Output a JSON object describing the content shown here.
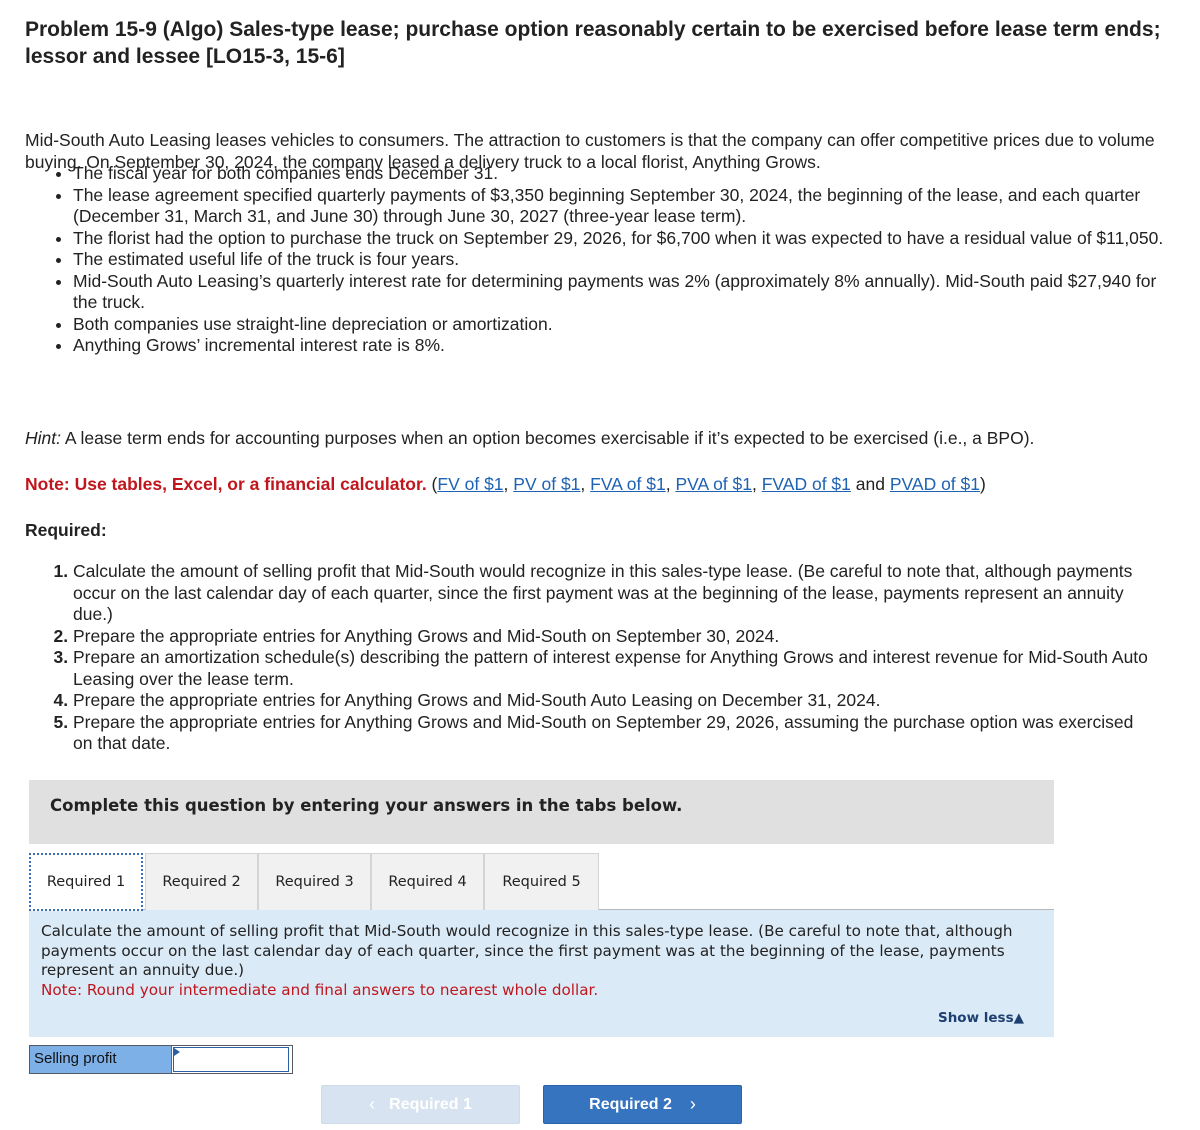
{
  "problem": {
    "title": "Problem 15-9 (Algo) Sales-type lease; purchase option reasonably certain to be exercised before lease term ends; lessor and lessee [LO15-3, 15-6]",
    "intro": "Mid-South Auto Leasing leases vehicles to consumers. The attraction to customers is that the company can offer competitive prices due to volume buying. On September 30, 2024, the company leased a delivery truck to a local florist, Anything Grows.",
    "facts": [
      "The fiscal year for both companies ends December 31.",
      "The lease agreement specified quarterly payments of $3,350 beginning September 30, 2024, the beginning of the lease, and each quarter (December 31, March 31, and June 30) through June 30, 2027 (three-year lease term).",
      "The florist had the option to purchase the truck on September 29, 2026, for $6,700 when it was expected to have a residual value of $11,050.",
      "The estimated useful life of the truck is four years.",
      "Mid-South Auto Leasing’s quarterly interest rate for determining payments was 2% (approximately 8% annually). Mid-South paid $27,940 for the truck.",
      "Both companies use straight-line depreciation or amortization.",
      "Anything Grows’ incremental interest rate is 8%."
    ],
    "hint_label": "Hint:",
    "hint_text": " A lease term ends for accounting purposes when an option becomes exercisable if it’s expected to be exercised (i.e., a BPO).",
    "note_label": "Note: Use tables, Excel, or a financial calculator.",
    "note_links": [
      "FV of $1",
      "PV of $1",
      "FVA of $1",
      "PVA of $1",
      "FVAD of $1",
      "PVAD of $1"
    ],
    "note_and": "and",
    "required_heading": "Required:",
    "required_items": [
      "Calculate the amount of selling profit that Mid-South would recognize in this sales-type lease. (Be careful to note that, although payments occur on the last calendar day of each quarter, since the first payment was at the beginning of the lease, payments represent an annuity due.)",
      "Prepare the appropriate entries for Anything Grows and Mid-South on September 30, 2024.",
      "Prepare an amortization schedule(s) describing the pattern of interest expense for Anything Grows and interest revenue for Mid-South Auto Leasing over the lease term.",
      "Prepare the appropriate entries for Anything Grows and Mid-South Auto Leasing on December 31, 2024.",
      "Prepare the appropriate entries for Anything Grows and Mid-South on September 29, 2026, assuming the purchase option was exercised on that date."
    ]
  },
  "question": {
    "banner": "Complete this question by entering your answers in the tabs below.",
    "tabs": [
      {
        "label": "Required 1",
        "active": true
      },
      {
        "label": "Required 2",
        "active": false
      },
      {
        "label": "Required 3",
        "active": false
      },
      {
        "label": "Required 4",
        "active": false
      },
      {
        "label": "Required 5",
        "active": false
      }
    ],
    "panel_text": "Calculate the amount of selling profit that Mid-South would recognize in this sales-type lease. (Be careful to note that, although payments occur on the last calendar day of each quarter, since the first payment was at the beginning of the lease, payments represent an annuity due.)",
    "panel_note": "Note: Round your intermediate and final answers to nearest whole dollar.",
    "show_less": "Show less",
    "show_less_icon": "▲",
    "answer_label": "Selling profit",
    "answer_value": "",
    "prev_button": "Required 1",
    "next_button": "Required 2",
    "prev_icon": "‹",
    "next_icon": "›",
    "colors": {
      "note_red": "#c0161d",
      "link_blue": "#1d62b5",
      "panel_bg": "#dbeaf7",
      "next_button_bg": "#3674bf",
      "prev_button_bg": "#d7e3f0",
      "label_cell_bg": "#7eb0e8"
    }
  }
}
